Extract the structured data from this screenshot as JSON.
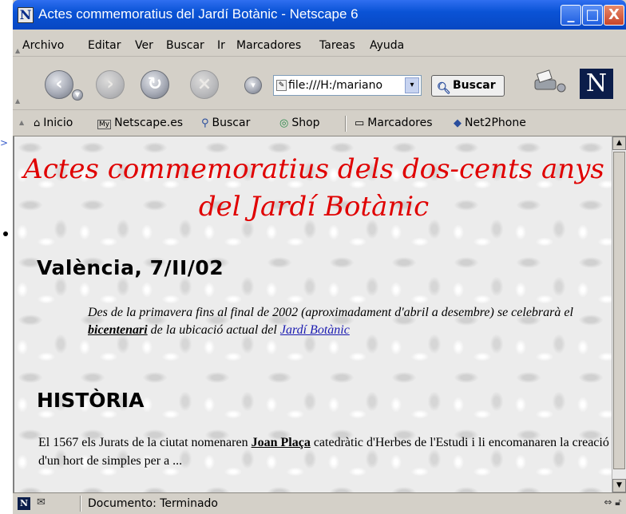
{
  "window": {
    "title": "Actes commemoratius del Jardí Botànic - Netscape 6",
    "logo_letter": "N",
    "minimize": "_",
    "maximize": "□",
    "close": "X"
  },
  "menu": [
    "Archivo",
    "Editar",
    "Ver",
    "Buscar",
    "Ir",
    "Marcadores",
    "Tareas",
    "Ayuda"
  ],
  "navigation": {
    "url": "file:///H:/mariano",
    "search_label": "Buscar",
    "brand": "N"
  },
  "personal_toolbar": {
    "items": [
      "Inicio",
      "Netscape.es",
      "Buscar",
      "Shop",
      "Marcadores",
      "Net2Phone"
    ],
    "my_badge": "My"
  },
  "page": {
    "title_line1": "Actes commemoratius dels dos-cents anys",
    "title_line2": "del Jardí Botànic",
    "date_heading": "València, 7/II/02",
    "intro_part1": "Des de la primavera fins al final de 2002 (aproximadament d'abril a desembre) se celebrarà el ",
    "intro_bold": "bicentenari",
    "intro_part2": " de la ubicació actual del ",
    "intro_link": "Jardí Botànic",
    "history_heading": "HISTÒRIA",
    "body_part1": "El 1567 els Jurats de la ciutat nomenaren ",
    "body_bold": "Joan Plaça",
    "body_part2": " catedràtic d'Herbes de l'Estudi i li encomanaren la creació d'un hort de simples per a ..."
  },
  "status": {
    "text": "Documento: Terminado",
    "badge_letter": "N"
  },
  "colors": {
    "title_red": "#e00000",
    "link_blue": "#1a1ab0",
    "titlebar_blue": "#0a53d6"
  },
  "icons": {
    "back": "back-arrow-icon",
    "forward": "forward-arrow-icon",
    "reload": "reload-icon",
    "stop": "stop-icon",
    "search": "magnifier-icon",
    "print": "printer-icon"
  }
}
